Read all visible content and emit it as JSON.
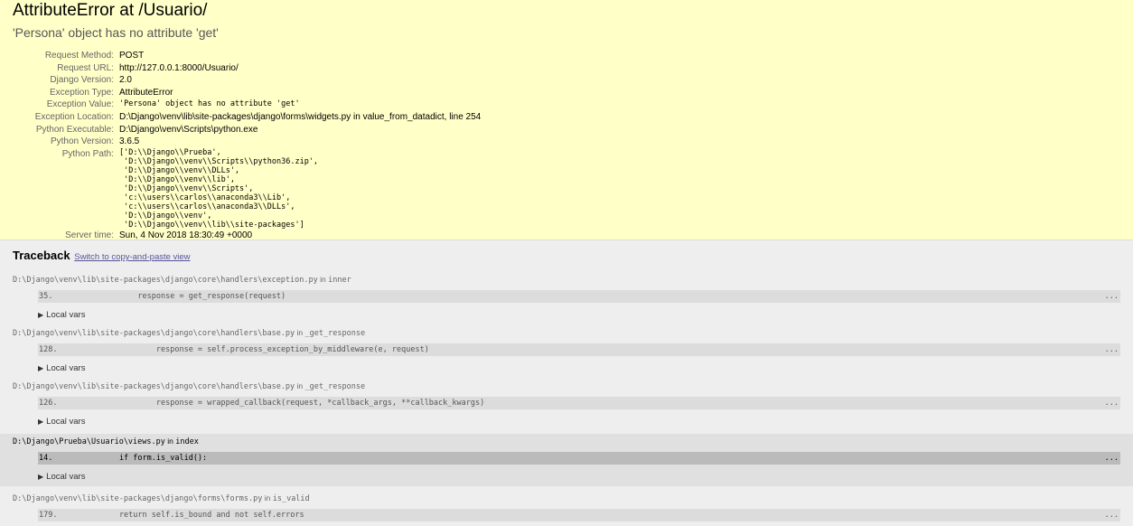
{
  "header": {
    "title": "AttributeError at /Usuario/",
    "exception_value": "'Persona' object has no attribute 'get'"
  },
  "meta": [
    {
      "label": "Request Method:",
      "value": "POST",
      "mono": false
    },
    {
      "label": "Request URL:",
      "value": "http://127.0.0.1:8000/Usuario/",
      "mono": false
    },
    {
      "label": "Django Version:",
      "value": "2.0",
      "mono": false
    },
    {
      "label": "Exception Type:",
      "value": "AttributeError",
      "mono": false
    },
    {
      "label": "Exception Value:",
      "value": "'Persona' object has no attribute 'get'",
      "mono": true
    },
    {
      "label": "Exception Location:",
      "value": "D:\\Django\\venv\\lib\\site-packages\\django\\forms\\widgets.py in value_from_datadict, line 254",
      "mono": false
    },
    {
      "label": "Python Executable:",
      "value": "D:\\Django\\venv\\Scripts\\python.exe",
      "mono": false
    },
    {
      "label": "Python Version:",
      "value": "3.6.5",
      "mono": false
    }
  ],
  "python_path": {
    "label": "Python Path:",
    "value": "['D:\\\\Django\\\\Prueba',\n 'D:\\\\Django\\\\venv\\\\Scripts\\\\python36.zip',\n 'D:\\\\Django\\\\venv\\\\DLLs',\n 'D:\\\\Django\\\\venv\\\\lib',\n 'D:\\\\Django\\\\venv\\\\Scripts',\n 'c:\\\\users\\\\carlos\\\\anaconda3\\\\Lib',\n 'c:\\\\users\\\\carlos\\\\anaconda3\\\\DLLs',\n 'D:\\\\Django\\\\venv',\n 'D:\\\\Django\\\\venv\\\\lib\\\\site-packages']"
  },
  "server_time": {
    "label": "Server time:",
    "value": "Sun, 4 Nov 2018 18:30:49 +0000"
  },
  "traceback": {
    "title": "Traceback",
    "switch_link": "Switch to copy-and-paste view",
    "in_word": "in",
    "local_vars_label": "Local vars",
    "dots": "...",
    "frames": [
      {
        "file": "D:\\Django\\venv\\lib\\site-packages\\django\\core\\handlers\\exception.py",
        "func": "inner",
        "lineno": "35.",
        "code": "            response = get_response(request)",
        "user": false
      },
      {
        "file": "D:\\Django\\venv\\lib\\site-packages\\django\\core\\handlers\\base.py",
        "func": "_get_response",
        "lineno": "128.",
        "code": "                response = self.process_exception_by_middleware(e, request)",
        "user": false
      },
      {
        "file": "D:\\Django\\venv\\lib\\site-packages\\django\\core\\handlers\\base.py",
        "func": "_get_response",
        "lineno": "126.",
        "code": "                response = wrapped_callback(request, *callback_args, **callback_kwargs)",
        "user": false
      },
      {
        "file": "D:\\Django\\Prueba\\Usuario\\views.py",
        "func": "index",
        "lineno": "14.",
        "code": "        if form.is_valid():",
        "user": true
      },
      {
        "file": "D:\\Django\\venv\\lib\\site-packages\\django\\forms\\forms.py",
        "func": "is_valid",
        "lineno": "179.",
        "code": "        return self.is_bound and not self.errors",
        "user": false
      }
    ]
  }
}
